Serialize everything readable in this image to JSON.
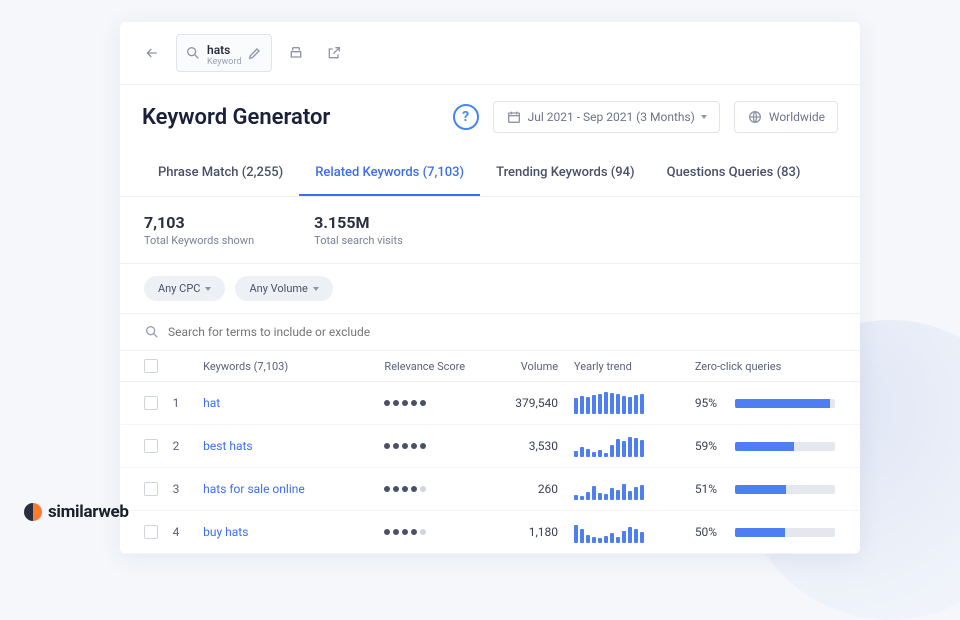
{
  "search": {
    "term": "hats",
    "type": "Keyword",
    "placeholder": "Search for terms to include or exclude"
  },
  "page_title": "Keyword Generator",
  "date_range": "Jul 2021 - Sep 2021 (3 Months)",
  "region": "Worldwide",
  "tabs": [
    {
      "label": "Phrase Match (2,255)"
    },
    {
      "label": "Related Keywords (7,103)"
    },
    {
      "label": "Trending Keywords (94)"
    },
    {
      "label": "Questions Queries (83)"
    }
  ],
  "active_tab": 1,
  "stats": {
    "total_keywords": {
      "value": "7,103",
      "label": "Total Keywords shown"
    },
    "total_visits": {
      "value": "3.155M",
      "label": "Total search visits"
    }
  },
  "filters": {
    "cpc": "Any CPC",
    "volume": "Any Volume"
  },
  "columns": {
    "chk": "",
    "idx": "",
    "kw": "Keywords (7,103)",
    "rel": "Relevance Score",
    "vol": "Volume",
    "trend": "Yearly trend",
    "zero": "Zero-click queries"
  },
  "rows": [
    {
      "idx": "1",
      "kw": "hat",
      "rel": 5,
      "vol": "379,540",
      "trend": [
        16,
        18,
        17,
        19,
        20,
        22,
        21,
        20,
        18,
        17,
        19,
        20
      ],
      "zero": "95%",
      "zero_w": 95
    },
    {
      "idx": "2",
      "kw": "best hats",
      "rel": 5,
      "vol": "3,530",
      "trend": [
        6,
        10,
        8,
        5,
        7,
        4,
        12,
        18,
        16,
        20,
        19,
        17
      ],
      "zero": "59%",
      "zero_w": 59
    },
    {
      "idx": "3",
      "kw": "hats for sale online",
      "rel": 4,
      "vol": "260",
      "trend": [
        5,
        4,
        8,
        14,
        7,
        6,
        12,
        10,
        16,
        9,
        13,
        15
      ],
      "zero": "51%",
      "zero_w": 51
    },
    {
      "idx": "4",
      "kw": "buy hats",
      "rel": 4,
      "vol": "1,180",
      "trend": [
        18,
        14,
        8,
        6,
        5,
        7,
        10,
        6,
        12,
        16,
        14,
        11
      ],
      "zero": "50%",
      "zero_w": 50
    }
  ],
  "brand": "similarweb"
}
